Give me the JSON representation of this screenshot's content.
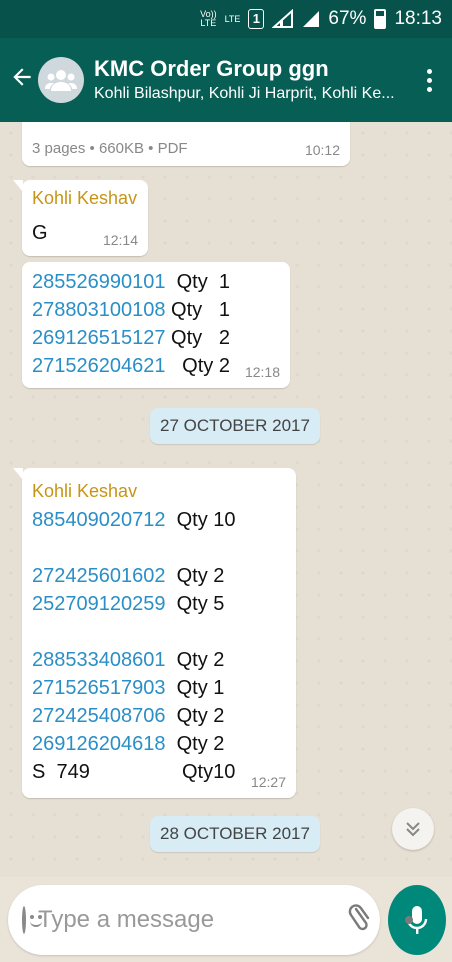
{
  "status_bar": {
    "volte": "Vo))",
    "volte_sub": "LTE",
    "lte": "LTE",
    "sim": "1",
    "battery": "67%",
    "time": "18:13"
  },
  "header": {
    "title": "KMC Order Group ggn",
    "subtitle": "Kohli Bilashpur, Kohli Ji Harprit, Kohli Ke..."
  },
  "messages": {
    "doc": {
      "meta": "3 pages • 660KB • PDF",
      "time": "10:12"
    },
    "msg1": {
      "sender": "Kohli Keshav",
      "text": "G",
      "time": "12:14"
    },
    "msg2": {
      "lines": [
        {
          "code": "285526990101",
          "qty": "Qty  1"
        },
        {
          "code": "278803100108",
          "qty": "Qty   1"
        },
        {
          "code": "269126515127",
          "qty": "Qty   2"
        },
        {
          "code": "271526204621",
          "qty": "Qty 2"
        }
      ],
      "time": "12:18"
    },
    "date1": "27 OCTOBER 2017",
    "msg3": {
      "sender": "Kohli Keshav",
      "lines": [
        {
          "code": "885409020712",
          "qty": "Qty 10"
        },
        {
          "code": "272425601602",
          "qty": "Qty 2"
        },
        {
          "code": "252709120259",
          "qty": "Qty 5"
        },
        {
          "code": "288533408601",
          "qty": "Qty 2"
        },
        {
          "code": "271526517903",
          "qty": "Qty 1"
        },
        {
          "code": "272425408706",
          "qty": "Qty 2"
        },
        {
          "code": "269126204618",
          "qty": "Qty 2"
        }
      ],
      "last_left": "S  749",
      "last_right": "Qty10",
      "time": "12:27"
    },
    "date2": "28 OCTOBER 2017"
  },
  "input": {
    "placeholder": "Type a message"
  },
  "icons": {
    "back": "arrow-left-icon",
    "menu": "more-vertical-icon",
    "emoji": "smiley-icon",
    "attach": "paperclip-icon",
    "camera": "camera-icon",
    "mic": "microphone-icon",
    "scroll": "chevrons-down-icon"
  },
  "colors": {
    "header": "#075e54",
    "accent": "#00897b",
    "sender": "#c79516",
    "link": "#2a8fc6",
    "date_chip": "#d7ecf4"
  }
}
